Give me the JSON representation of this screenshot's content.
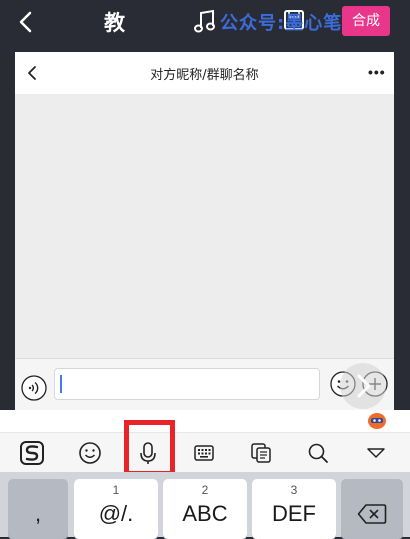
{
  "editor": {
    "title": "教",
    "watermark": "公众号:墨心笔记",
    "compose_label": "合成"
  },
  "chat": {
    "title": "对方昵称/群聊名称",
    "more": "•••"
  },
  "toolbar": {
    "items": [
      "sogou-logo-icon",
      "emoji-icon",
      "microphone-icon",
      "keyboard-icon",
      "clipboard-icon",
      "search-icon",
      "collapse-icon"
    ]
  },
  "keyboard": {
    "keys": [
      {
        "num": "",
        "main": ","
      },
      {
        "num": "1",
        "main": "@/."
      },
      {
        "num": "2",
        "main": "ABC"
      },
      {
        "num": "3",
        "main": "DEF"
      }
    ]
  },
  "colors": {
    "accent_pink": "#e8378a",
    "highlight_red": "#e8232a",
    "watermark_blue": "#3d6fe3"
  }
}
